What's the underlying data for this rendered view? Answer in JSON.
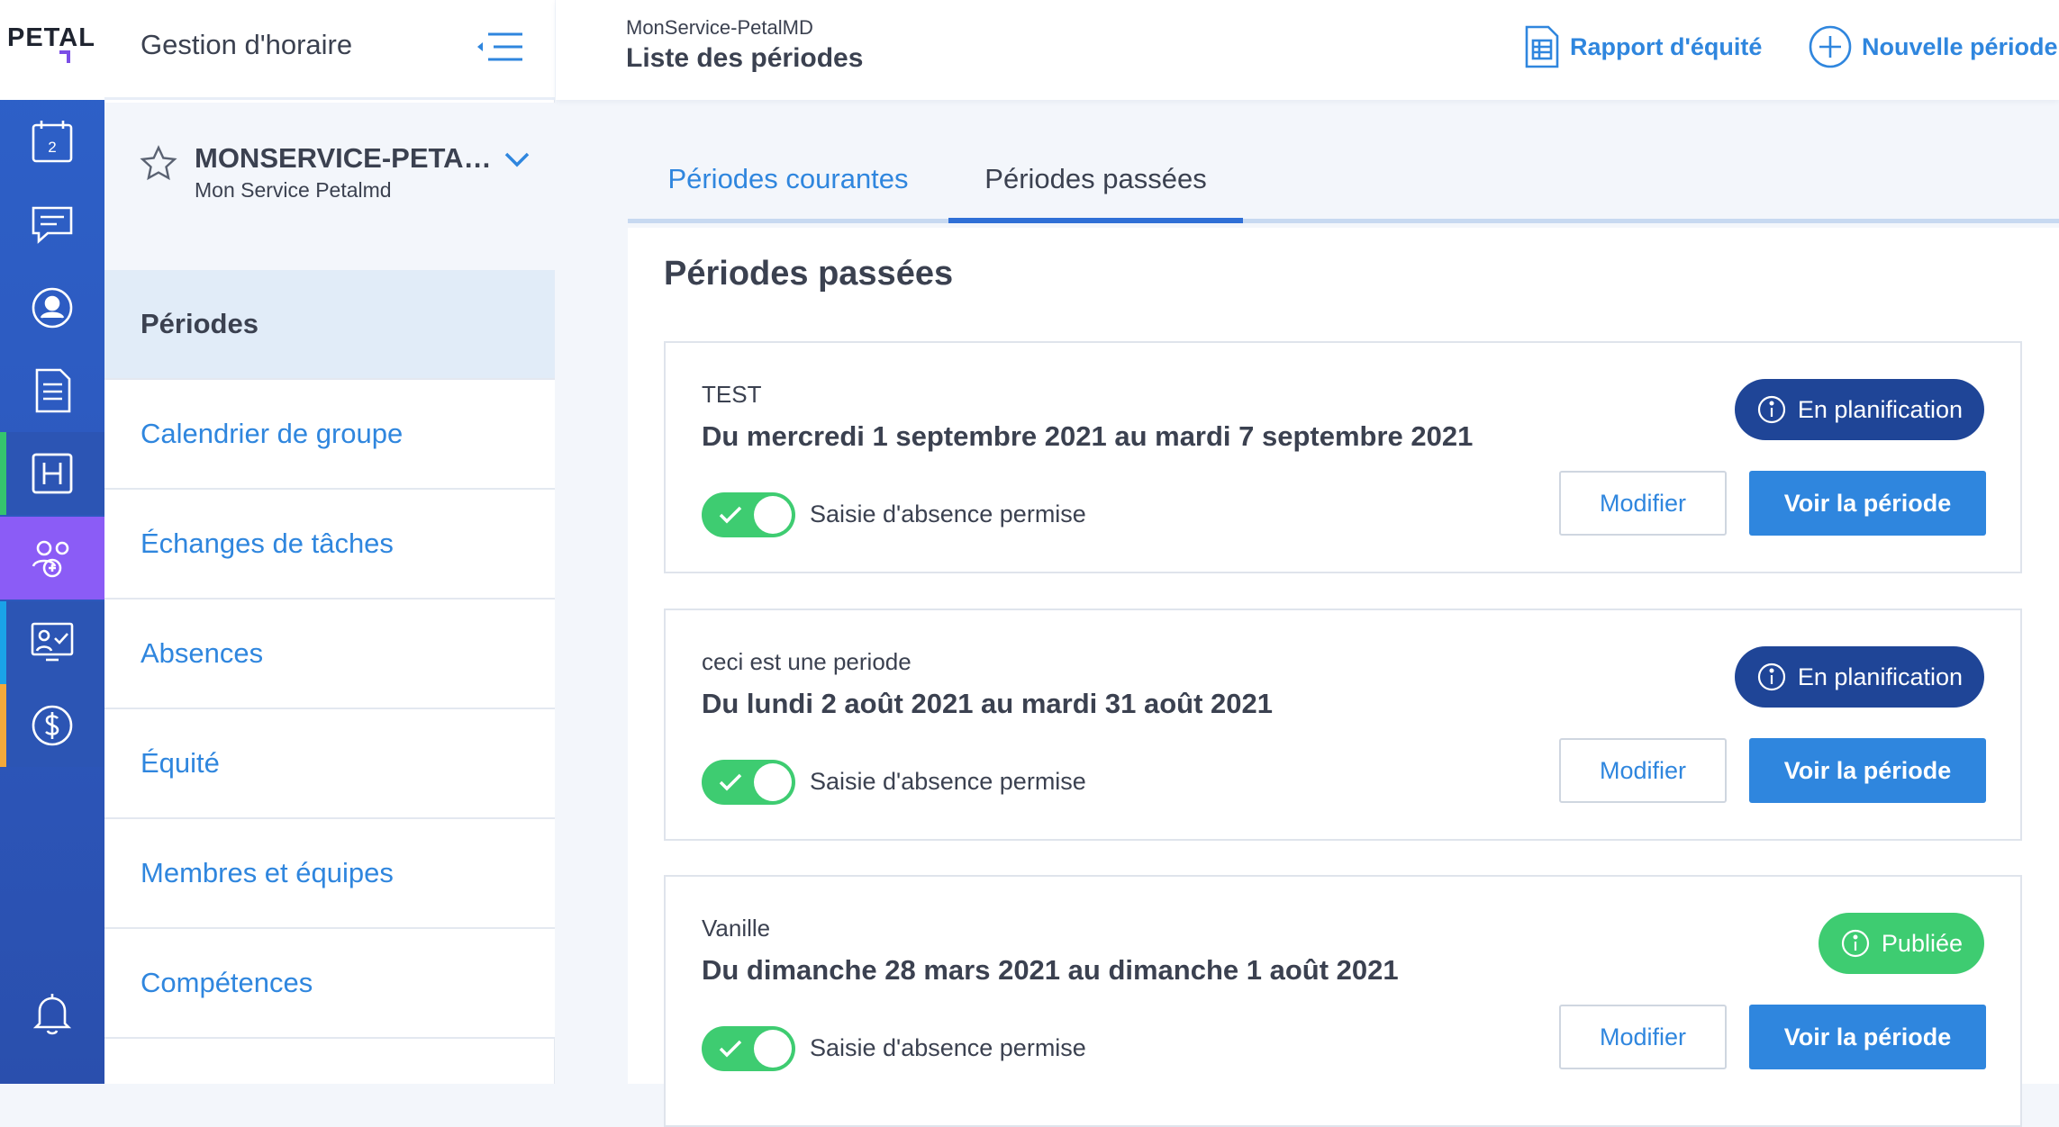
{
  "app": {
    "logo": "PETAL"
  },
  "rail": {
    "items": [
      {
        "name": "calendar-icon",
        "badge": "2"
      },
      {
        "name": "chat-icon"
      },
      {
        "name": "user-icon"
      },
      {
        "name": "document-icon"
      },
      {
        "name": "h-schedule-icon",
        "accent": "#35c46e"
      },
      {
        "name": "group-icon",
        "active_bg": "#8b5cf6"
      },
      {
        "name": "presentation-icon",
        "accent": "#1aa3e8"
      },
      {
        "name": "dollar-icon",
        "accent": "#f2a93b"
      },
      {
        "name": "bell-icon"
      }
    ]
  },
  "sidebar": {
    "title": "Gestion d'horaire",
    "service": {
      "name": "MONSERVICE-PETAL...",
      "subtitle": "Mon Service Petalmd"
    },
    "items": [
      {
        "label": "Périodes",
        "active": true
      },
      {
        "label": "Calendrier de groupe"
      },
      {
        "label": "Échanges de tâches"
      },
      {
        "label": "Absences"
      },
      {
        "label": "Équité"
      },
      {
        "label": "Membres et équipes"
      },
      {
        "label": "Compétences"
      }
    ]
  },
  "header": {
    "breadcrumb": "MonService-PetalMD",
    "title": "Liste des périodes",
    "actions": {
      "report": "Rapport d'équité",
      "new_period": "Nouvelle période"
    }
  },
  "tabs": [
    {
      "label": "Périodes courantes"
    },
    {
      "label": "Périodes passées",
      "active": true
    }
  ],
  "section": {
    "title": "Périodes passées",
    "periods": [
      {
        "name": "TEST",
        "dates": "Du mercredi 1 septembre 2021 au mardi 7 septembre 2021",
        "toggle_label": "Saisie d'absence permise",
        "toggle_on": true,
        "status": "En planification",
        "edit": "Modifier",
        "view": "Voir la période"
      },
      {
        "name": "ceci est une periode",
        "dates": "Du lundi 2 août 2021 au mardi 31 août 2021",
        "toggle_label": "Saisie d'absence permise",
        "toggle_on": true,
        "status": "En planification",
        "edit": "Modifier",
        "view": "Voir la période"
      },
      {
        "name": "Vanille",
        "dates": "Du dimanche 28 mars 2021 au dimanche 1 août 2021",
        "toggle_label": "Saisie d'absence permise",
        "toggle_on": true,
        "status": "Publiée",
        "edit": "Modifier",
        "view": "Voir la période"
      }
    ]
  },
  "colors": {
    "primary": "#2f86de",
    "planning_badge": "#1f4597",
    "published_badge": "#3ecc71",
    "rail": "#2d5bc2"
  }
}
